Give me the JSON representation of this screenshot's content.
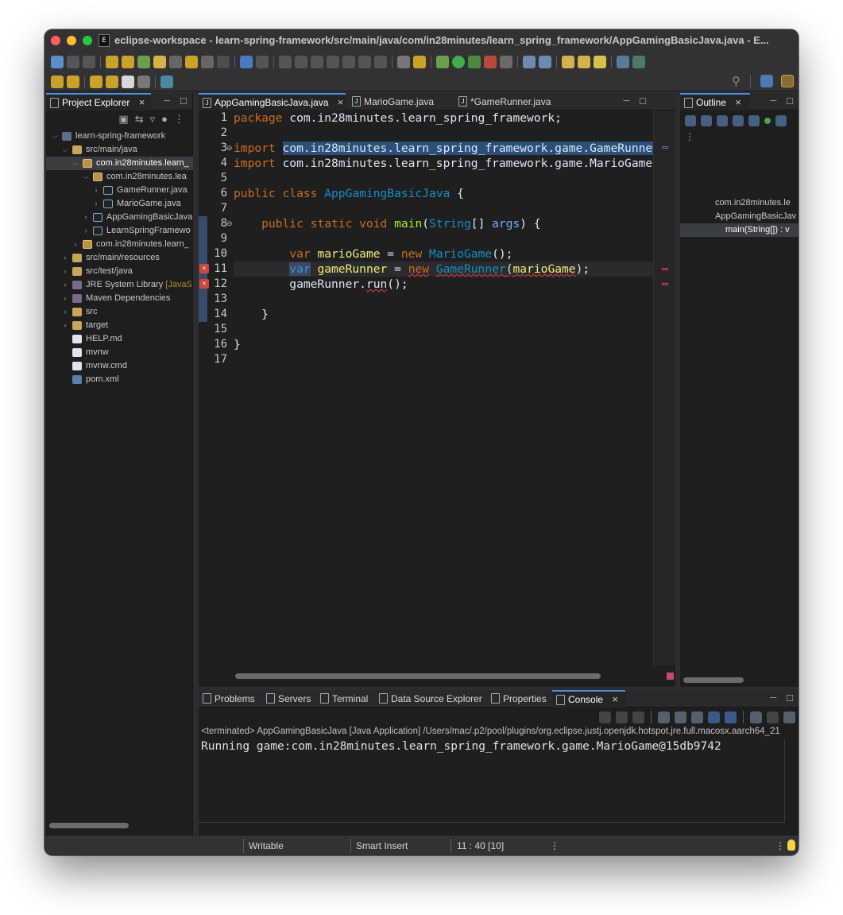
{
  "window": {
    "title": "eclipse-workspace - learn-spring-framework/src/main/java/com/in28minutes/learn_spring_framework/AppGamingBasicJava.java - E...",
    "app_icon": "eclipse-ide-icon"
  },
  "colors": {
    "keyword": "#cc6c1d",
    "type": "#1290c3",
    "method": "#a7ec21",
    "variable": "#f3ec79",
    "error": "#e04040",
    "selection": "#2c4f7a",
    "active_tab_accent": "#4a90e2"
  },
  "explorer": {
    "tab_label": "Project Explorer",
    "tree": [
      {
        "label": "learn-spring-framework",
        "indent": 0,
        "caret": "v",
        "icon": "project"
      },
      {
        "label": "src/main/java",
        "indent": 1,
        "caret": "v",
        "icon": "folder"
      },
      {
        "label": "com.in28minutes.learn_",
        "indent": 2,
        "caret": "v",
        "icon": "package",
        "selected": true
      },
      {
        "label": "com.in28minutes.lea",
        "indent": 3,
        "caret": "v",
        "icon": "package"
      },
      {
        "label": "GameRunner.java",
        "indent": 4,
        "caret": ">",
        "icon": "java"
      },
      {
        "label": "MarioGame.java",
        "indent": 4,
        "caret": ">",
        "icon": "java"
      },
      {
        "label": "AppGamingBasicJava",
        "indent": 3,
        "caret": ">",
        "icon": "java"
      },
      {
        "label": "LearnSpringFramewo",
        "indent": 3,
        "caret": ">",
        "icon": "java"
      },
      {
        "label": "com.in28minutes.learn_",
        "indent": 2,
        "caret": ">",
        "icon": "package"
      },
      {
        "label": "src/main/resources",
        "indent": 1,
        "caret": ">",
        "icon": "folder"
      },
      {
        "label": "src/test/java",
        "indent": 1,
        "caret": ">",
        "icon": "folder"
      },
      {
        "label": "JRE System Library",
        "suffix": "[JavaS",
        "indent": 1,
        "caret": ">",
        "icon": "library"
      },
      {
        "label": "Maven Dependencies",
        "indent": 1,
        "caret": ">",
        "icon": "library"
      },
      {
        "label": "src",
        "indent": 1,
        "caret": ">",
        "icon": "folder"
      },
      {
        "label": "target",
        "indent": 1,
        "caret": ">",
        "icon": "folder"
      },
      {
        "label": "HELP.md",
        "indent": 1,
        "caret": "",
        "icon": "file"
      },
      {
        "label": "mvnw",
        "indent": 1,
        "caret": "",
        "icon": "file"
      },
      {
        "label": "mvnw.cmd",
        "indent": 1,
        "caret": "",
        "icon": "file"
      },
      {
        "label": "pom.xml",
        "indent": 1,
        "caret": "",
        "icon": "xml"
      }
    ]
  },
  "editor": {
    "tabs": [
      {
        "label": "AppGamingBasicJava.java",
        "active": true,
        "close": "×"
      },
      {
        "label": "MarioGame.java",
        "active": false,
        "close": ""
      },
      {
        "label": "*GameRunner.java",
        "active": false,
        "close": ""
      }
    ],
    "line_numbers": [
      "1",
      "2",
      "3",
      "4",
      "5",
      "6",
      "7",
      "8",
      "9",
      "10",
      "11",
      "12",
      "13",
      "14",
      "15",
      "16",
      "17"
    ],
    "code": [
      [
        {
          "t": "package ",
          "c": "kw"
        },
        {
          "t": "com.in28minutes.learn_spring_framework;",
          "c": ""
        }
      ],
      [],
      [
        {
          "t": "import ",
          "c": "kw"
        },
        {
          "t": "com.in28minutes.learn_spring_framework.game.GameRunner;",
          "c": "hl"
        }
      ],
      [
        {
          "t": "import ",
          "c": "kw"
        },
        {
          "t": "com.in28minutes.learn_spring_framework.game.MarioGame;",
          "c": ""
        }
      ],
      [],
      [
        {
          "t": "public ",
          "c": "kw"
        },
        {
          "t": "class ",
          "c": "kw"
        },
        {
          "t": "AppGamingBasicJava",
          "c": "cls"
        },
        {
          "t": " {",
          "c": ""
        }
      ],
      [],
      [
        {
          "t": "    public ",
          "c": "kw"
        },
        {
          "t": "static ",
          "c": "kw"
        },
        {
          "t": "void ",
          "c": "kw"
        },
        {
          "t": "main",
          "c": "fn"
        },
        {
          "t": "(",
          "c": ""
        },
        {
          "t": "String",
          "c": "tp"
        },
        {
          "t": "[] ",
          "c": ""
        },
        {
          "t": "args",
          "c": "param"
        },
        {
          "t": ") {",
          "c": ""
        }
      ],
      [],
      [
        {
          "t": "        var ",
          "c": "kw"
        },
        {
          "t": "marioGame",
          "c": "vr"
        },
        {
          "t": " = ",
          "c": ""
        },
        {
          "t": "new ",
          "c": "kw"
        },
        {
          "t": "MarioGame",
          "c": "tp"
        },
        {
          "t": "();",
          "c": ""
        }
      ],
      [
        {
          "t": "        ",
          "c": ""
        },
        {
          "t": "var",
          "c": "hlkw"
        },
        {
          "t": " ",
          "c": ""
        },
        {
          "t": "gameRunner",
          "c": "vr"
        },
        {
          "t": " = ",
          "c": ""
        },
        {
          "t": "new",
          "c": "kw err"
        },
        {
          "t": " ",
          "c": ""
        },
        {
          "t": "GameRunner",
          "c": "tp err"
        },
        {
          "t": "(",
          "c": "err"
        },
        {
          "t": "marioGame",
          "c": "vr err"
        },
        {
          "t": ");",
          "c": ""
        }
      ],
      [
        {
          "t": "        gameRunner.",
          "c": ""
        },
        {
          "t": "run",
          "c": "err"
        },
        {
          "t": "();",
          "c": ""
        }
      ],
      [],
      [
        {
          "t": "    }",
          "c": ""
        }
      ],
      [],
      [
        {
          "t": "}",
          "c": ""
        }
      ],
      []
    ]
  },
  "outline": {
    "tab_label": "Outline",
    "items": [
      {
        "label": "com.in28minutes.le",
        "selected": false
      },
      {
        "label": "AppGamingBasicJav",
        "selected": false
      },
      {
        "label": "main(String[]) : v",
        "selected": true
      }
    ]
  },
  "bottom_panel": {
    "tabs": [
      "Problems",
      "Servers",
      "Terminal",
      "Data Source Explorer",
      "Properties",
      "Console"
    ],
    "active_tab": "Console",
    "close": "×",
    "status_line": "<terminated> AppGamingBasicJava [Java Application] /Users/mac/.p2/pool/plugins/org.eclipse.justj.openjdk.hotspot.jre.full.macosx.aarch64_21",
    "output": "Running game:com.in28minutes.learn_spring_framework.game.MarioGame@15db9742"
  },
  "statusbar": {
    "mode": "Writable",
    "insert": "Smart Insert",
    "position": "11 : 40 [10]"
  }
}
